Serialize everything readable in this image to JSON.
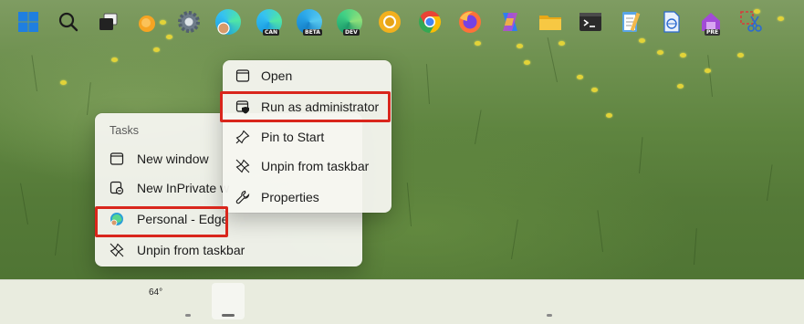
{
  "jumplist": {
    "section_title": "Tasks",
    "items": [
      {
        "label": "New window",
        "icon": "window-icon"
      },
      {
        "label": "New InPrivate w",
        "icon": "inprivate-window-icon"
      },
      {
        "label": "Personal - Edge",
        "icon": "edge-profile-icon"
      },
      {
        "label": "Unpin from taskbar",
        "icon": "unpin-icon"
      }
    ]
  },
  "context_menu": {
    "items": [
      {
        "label": "Open",
        "icon": "window-icon"
      },
      {
        "label": "Run as administrator",
        "icon": "shield-window-icon"
      },
      {
        "label": "Pin to Start",
        "icon": "pin-icon"
      },
      {
        "label": "Unpin from taskbar",
        "icon": "unpin-icon"
      },
      {
        "label": "Properties",
        "icon": "wrench-icon"
      }
    ]
  },
  "highlight_color": "#d9261c",
  "taskbar": {
    "weather_temp": "64°",
    "icons": [
      "windows-start-icon",
      "search-icon",
      "task-view-icon",
      "weather-icon",
      "settings-icon",
      "edge-icon",
      "edge-canary-icon",
      "edge-beta-icon",
      "edge-dev-icon",
      "chrome-canary-icon",
      "chrome-icon",
      "firefox-icon",
      "copilot-icon",
      "file-explorer-icon",
      "terminal-icon",
      "notepad-icon",
      "word-icon",
      "powertoys-icon",
      "snipping-tool-icon"
    ],
    "badges": {
      "canary": "CAN",
      "beta": "BETA",
      "dev": "DEV",
      "preview": "PRE"
    }
  }
}
